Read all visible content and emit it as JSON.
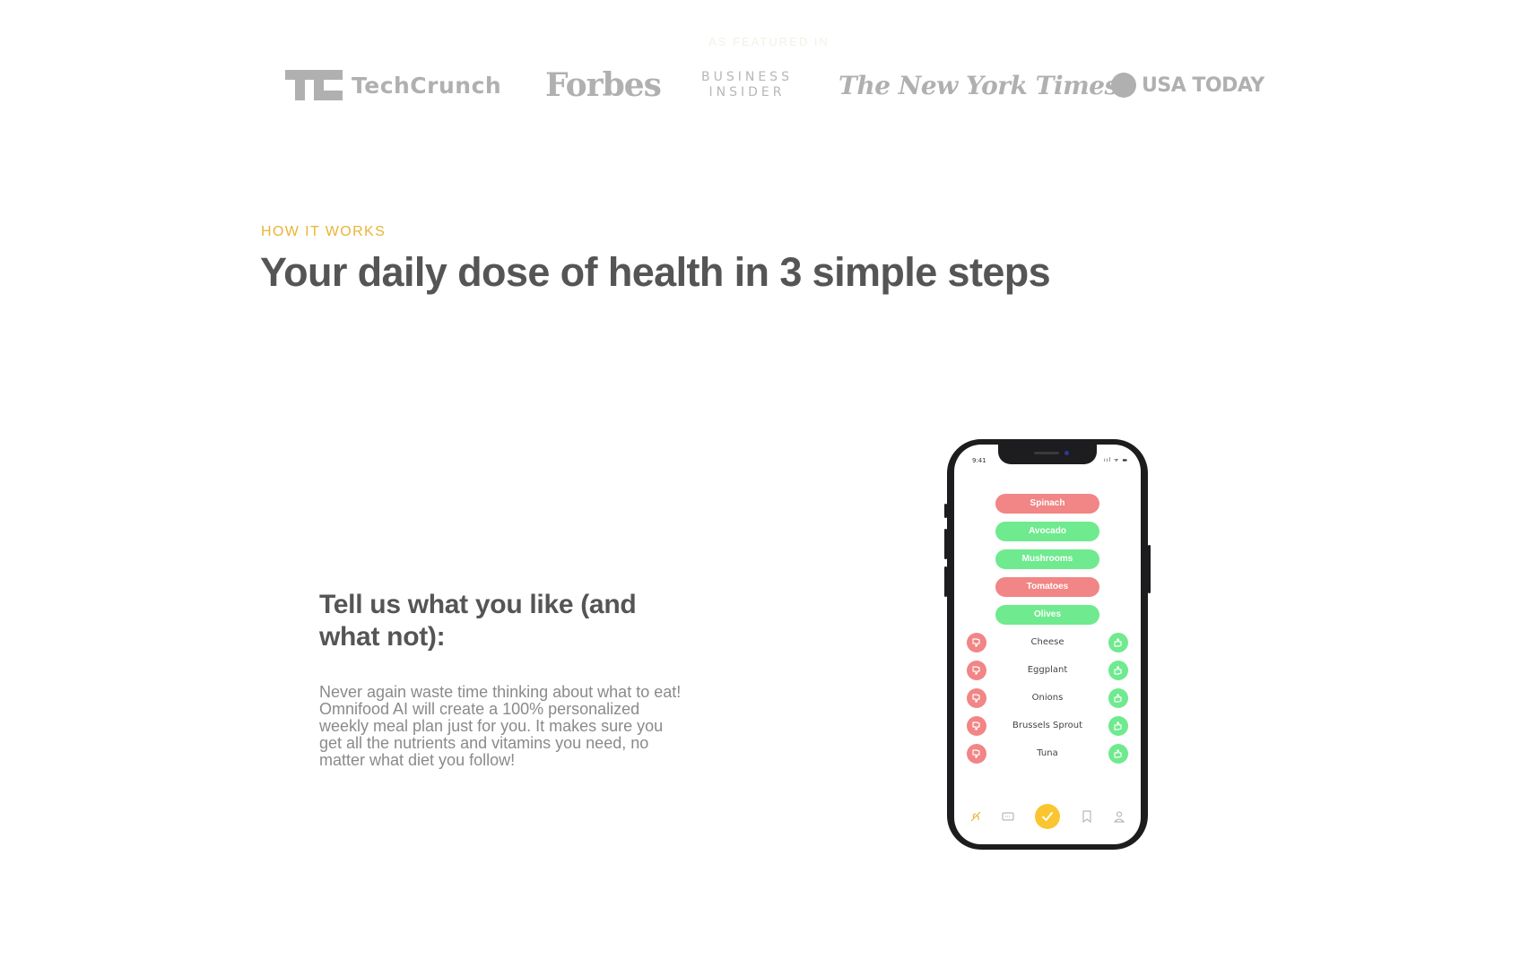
{
  "featured": {
    "heading": "As featured in",
    "logos": {
      "techcrunch": "TechCrunch",
      "forbes": "Forbes",
      "business_insider_line1": "BUSINESS",
      "business_insider_line2": "INSIDER",
      "nyt": "The New York Times",
      "usa_today": "USA TODAY"
    }
  },
  "how_it_works": {
    "subheading": "HOW IT WORKS",
    "heading": "Your daily dose of health in 3 simple steps",
    "step": {
      "title": "Tell us what you like (and what not):",
      "description": "Never again waste time thinking about what to eat! Omnifood AI will create a 100% personalized weekly meal plan just for you. It makes sure you get all the nutrients and vitamins you need, no matter what diet you follow!"
    }
  },
  "phone": {
    "status_time": "9:41",
    "status_icons": "ııl ᯤ ▬",
    "pills": [
      {
        "label": "Spinach",
        "type": "dislike"
      },
      {
        "label": "Avocado",
        "type": "like"
      },
      {
        "label": "Mushrooms",
        "type": "like"
      },
      {
        "label": "Tomatoes",
        "type": "dislike"
      },
      {
        "label": "Olives",
        "type": "like"
      }
    ],
    "foods": [
      "Cheese",
      "Eggplant",
      "Onions",
      "Brussels Sprout",
      "Tuna"
    ],
    "tabbar_icons": [
      "plant-icon",
      "chat-icon",
      "check-icon",
      "bookmark-icon",
      "profile-icon"
    ]
  },
  "colors": {
    "accent": "#e8b535",
    "heading": "#555555",
    "logo_gray": "#b0b0b0",
    "dislike": "#f28585",
    "like": "#6fea8e",
    "tab_active": "#fbc531"
  }
}
